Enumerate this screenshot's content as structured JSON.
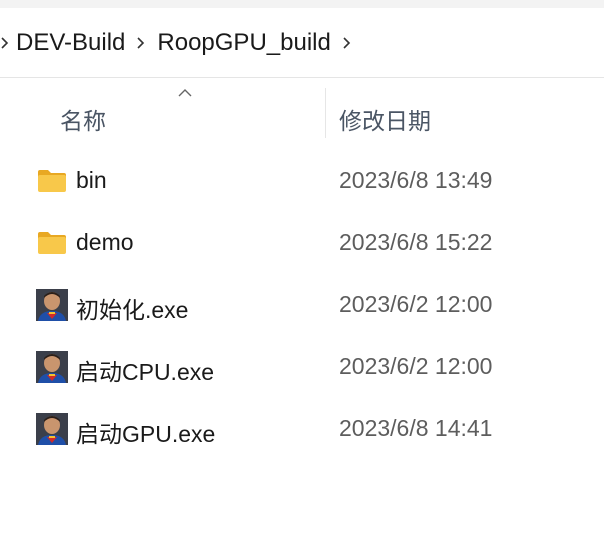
{
  "breadcrumb": {
    "items": [
      "DEV-Build",
      "RoopGPU_build"
    ]
  },
  "columns": {
    "name": "名称",
    "date_modified": "修改日期",
    "sort_indicator": "ascending"
  },
  "files": [
    {
      "name": "bin",
      "date": "2023/6/8 13:49",
      "icon": "folder-icon"
    },
    {
      "name": "demo",
      "date": "2023/6/8 15:22",
      "icon": "folder-icon"
    },
    {
      "name": "初始化.exe",
      "date": "2023/6/2 12:00",
      "icon": "app-portrait-icon"
    },
    {
      "name": "启动CPU.exe",
      "date": "2023/6/2 12:00",
      "icon": "app-portrait-icon"
    },
    {
      "name": "启动GPU.exe",
      "date": "2023/6/8 14:41",
      "icon": "app-portrait-icon"
    }
  ],
  "colors": {
    "folder": "#f8c84a",
    "folder_dark": "#e8a823",
    "header_text": "#4a5564",
    "date_text": "#5d5d5d"
  }
}
